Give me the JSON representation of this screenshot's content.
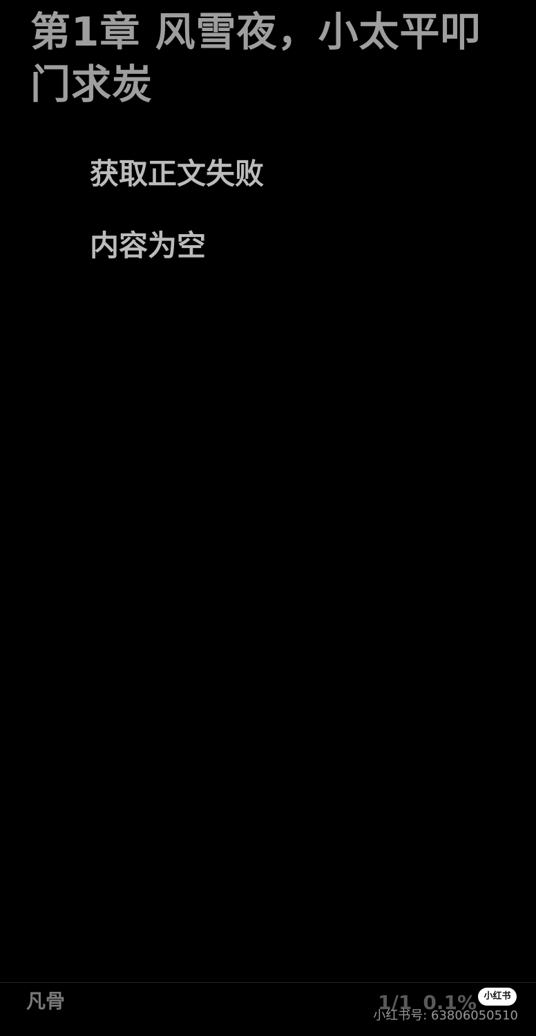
{
  "chapter": {
    "title": "第1章 风雪夜，小太平叩门求炭"
  },
  "content": {
    "paragraphs": [
      "获取正文失败",
      "内容为空"
    ]
  },
  "footer": {
    "book_name": "凡骨",
    "page_indicator": "1/1",
    "progress_percent": "0.1%"
  },
  "watermark": {
    "logo_text": "小红书",
    "user_id": "小红书号: 63806050510"
  },
  "colors": {
    "background": "#000000",
    "title_text": "#9e9e9e",
    "body_text": "#bcbcbc",
    "footer_text": "#7a7a7a"
  }
}
